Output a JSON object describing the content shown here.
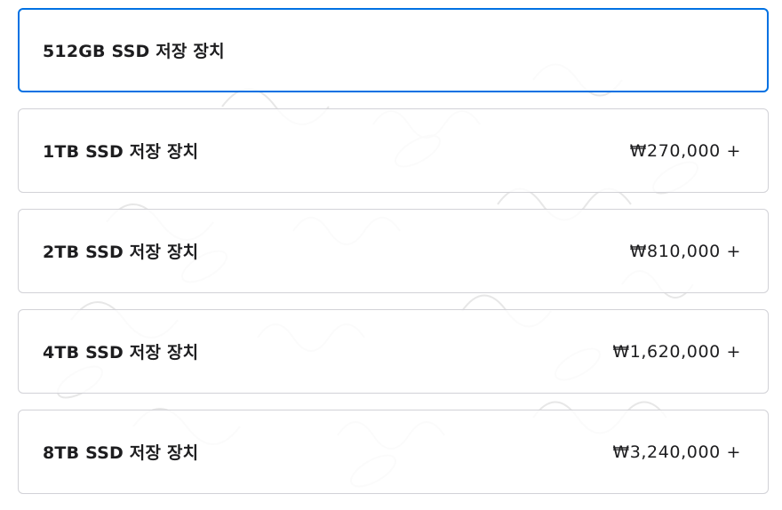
{
  "storage_options": [
    {
      "label": "512GB SSD 저장 장치",
      "price": "",
      "selected": true
    },
    {
      "label": "1TB SSD 저장 장치",
      "price": "₩270,000 +",
      "selected": false
    },
    {
      "label": "2TB SSD 저장 장치",
      "price": "₩810,000 +",
      "selected": false
    },
    {
      "label": "4TB SSD 저장 장치",
      "price": "₩1,620,000 +",
      "selected": false
    },
    {
      "label": "8TB SSD 저장 장치",
      "price": "₩3,240,000 +",
      "selected": false
    }
  ],
  "colors": {
    "accent": "#0071e3",
    "border": "#d2d2d7",
    "text": "#1d1d1f"
  }
}
